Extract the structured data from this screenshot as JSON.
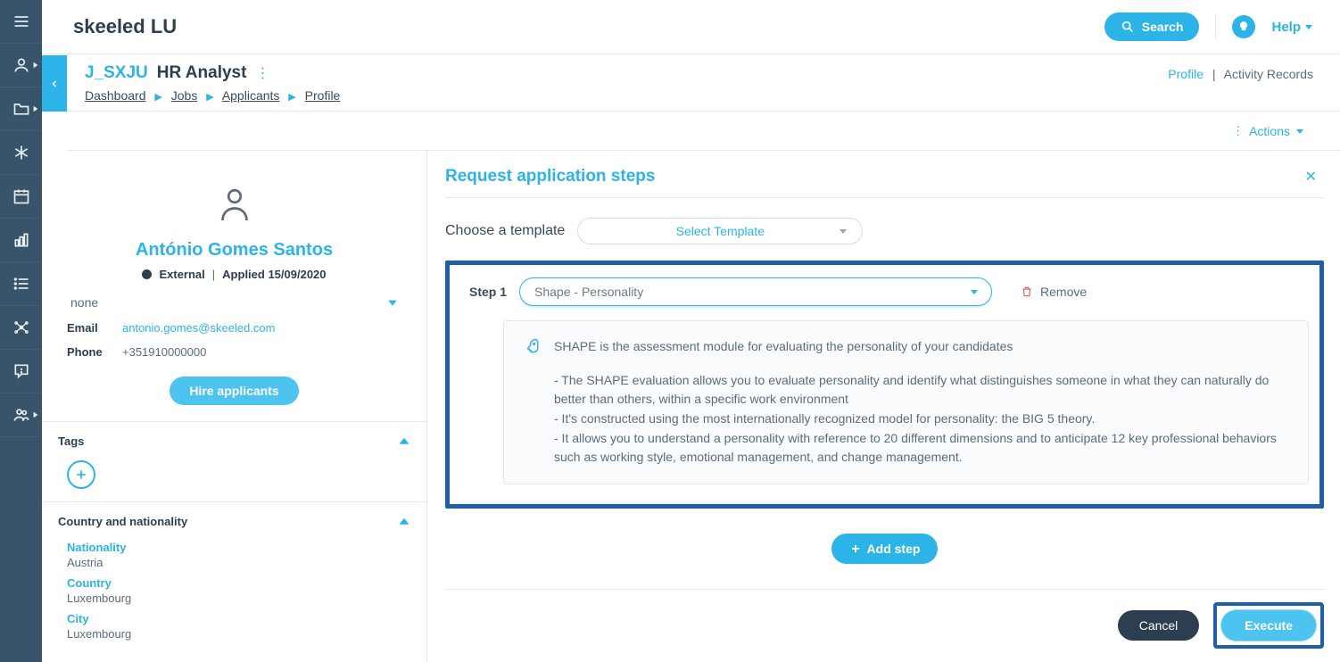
{
  "topbar": {
    "brand": "skeeled LU",
    "search": "Search",
    "help": "Help"
  },
  "job": {
    "code": "J_SXJU",
    "title": "HR Analyst",
    "right": {
      "profile": "Profile",
      "sep": "|",
      "activity": "Activity Records"
    },
    "breadcrumb": {
      "dashboard": "Dashboard",
      "jobs": "Jobs",
      "applicants": "Applicants",
      "profile": "Profile"
    }
  },
  "actions": {
    "label": "Actions"
  },
  "candidate": {
    "name": "António Gomes Santos",
    "origin": "External",
    "applied_sep": "|",
    "applied": "Applied 15/09/2020",
    "none": "none",
    "email_label": "Email",
    "email": "antonio.gomes@skeeled.com",
    "phone_label": "Phone",
    "phone": "+351910000000",
    "hire": "Hire applicants"
  },
  "sections": {
    "tags": "Tags",
    "country_nat": "Country and nationality",
    "nationality_k": "Nationality",
    "nationality_v": "Austria",
    "country_k": "Country",
    "country_v": "Luxembourg",
    "city_k": "City",
    "city_v": "Luxembourg"
  },
  "modal": {
    "title": "Request application steps",
    "choose_template": "Choose a template",
    "select_template": "Select Template",
    "step1_label": "Step 1",
    "step1_value": "Shape - Personality",
    "remove": "Remove",
    "desc_intro": "SHAPE is the assessment module for evaluating the personality of your candidates",
    "desc_b1": "- The SHAPE evaluation allows you to evaluate personality and identify what distinguishes someone in what they can naturally do better than others, within a specific work environment",
    "desc_b2": "- It's constructed using the most internationally recognized model for personality: the BIG 5 theory.",
    "desc_b3": "- It allows you to understand a personality with reference to 20 different dimensions and to anticipate 12 key professional behaviors such as working style, emotional management, and change management.",
    "add_step": "Add step",
    "cancel": "Cancel",
    "execute": "Execute"
  }
}
